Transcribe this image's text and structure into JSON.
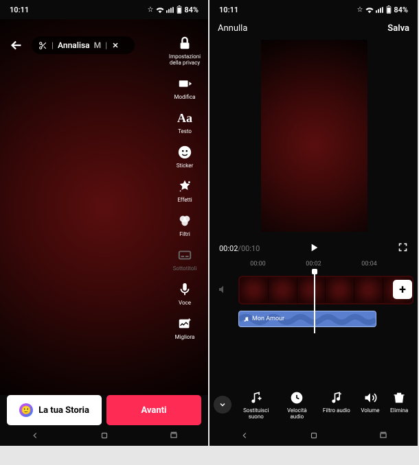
{
  "status": {
    "time": "10:11",
    "battery": "84%"
  },
  "left": {
    "music_pill": "Annalisa",
    "music_pill_extra": "M",
    "tools": [
      {
        "id": "privacy",
        "label": "Impostazioni della privacy"
      },
      {
        "id": "edit",
        "label": "Modifica"
      },
      {
        "id": "text",
        "label": "Testo"
      },
      {
        "id": "sticker",
        "label": "Sticker"
      },
      {
        "id": "effects",
        "label": "Effetti"
      },
      {
        "id": "filters",
        "label": "Filtri"
      },
      {
        "id": "subtitles",
        "label": "Sottotitoli"
      },
      {
        "id": "voice",
        "label": "Voce"
      },
      {
        "id": "enhance",
        "label": "Migliora"
      }
    ],
    "story_button": "La tua Storia",
    "next_button": "Avanti"
  },
  "right": {
    "cancel": "Annulla",
    "save": "Salva",
    "time_current": "00:02",
    "time_separator": "/",
    "time_total": "00:10",
    "ruler": [
      "00:00",
      "00:02",
      "00:04"
    ],
    "audio_clip": "Mon Amour",
    "bottom_tools": [
      {
        "id": "replace-sound",
        "label": "Sostituisci suono"
      },
      {
        "id": "speed",
        "label": "Velocità audio"
      },
      {
        "id": "audio-filter",
        "label": "Filtro audio"
      },
      {
        "id": "volume",
        "label": "Volume"
      },
      {
        "id": "delete",
        "label": "Elimina"
      }
    ]
  }
}
